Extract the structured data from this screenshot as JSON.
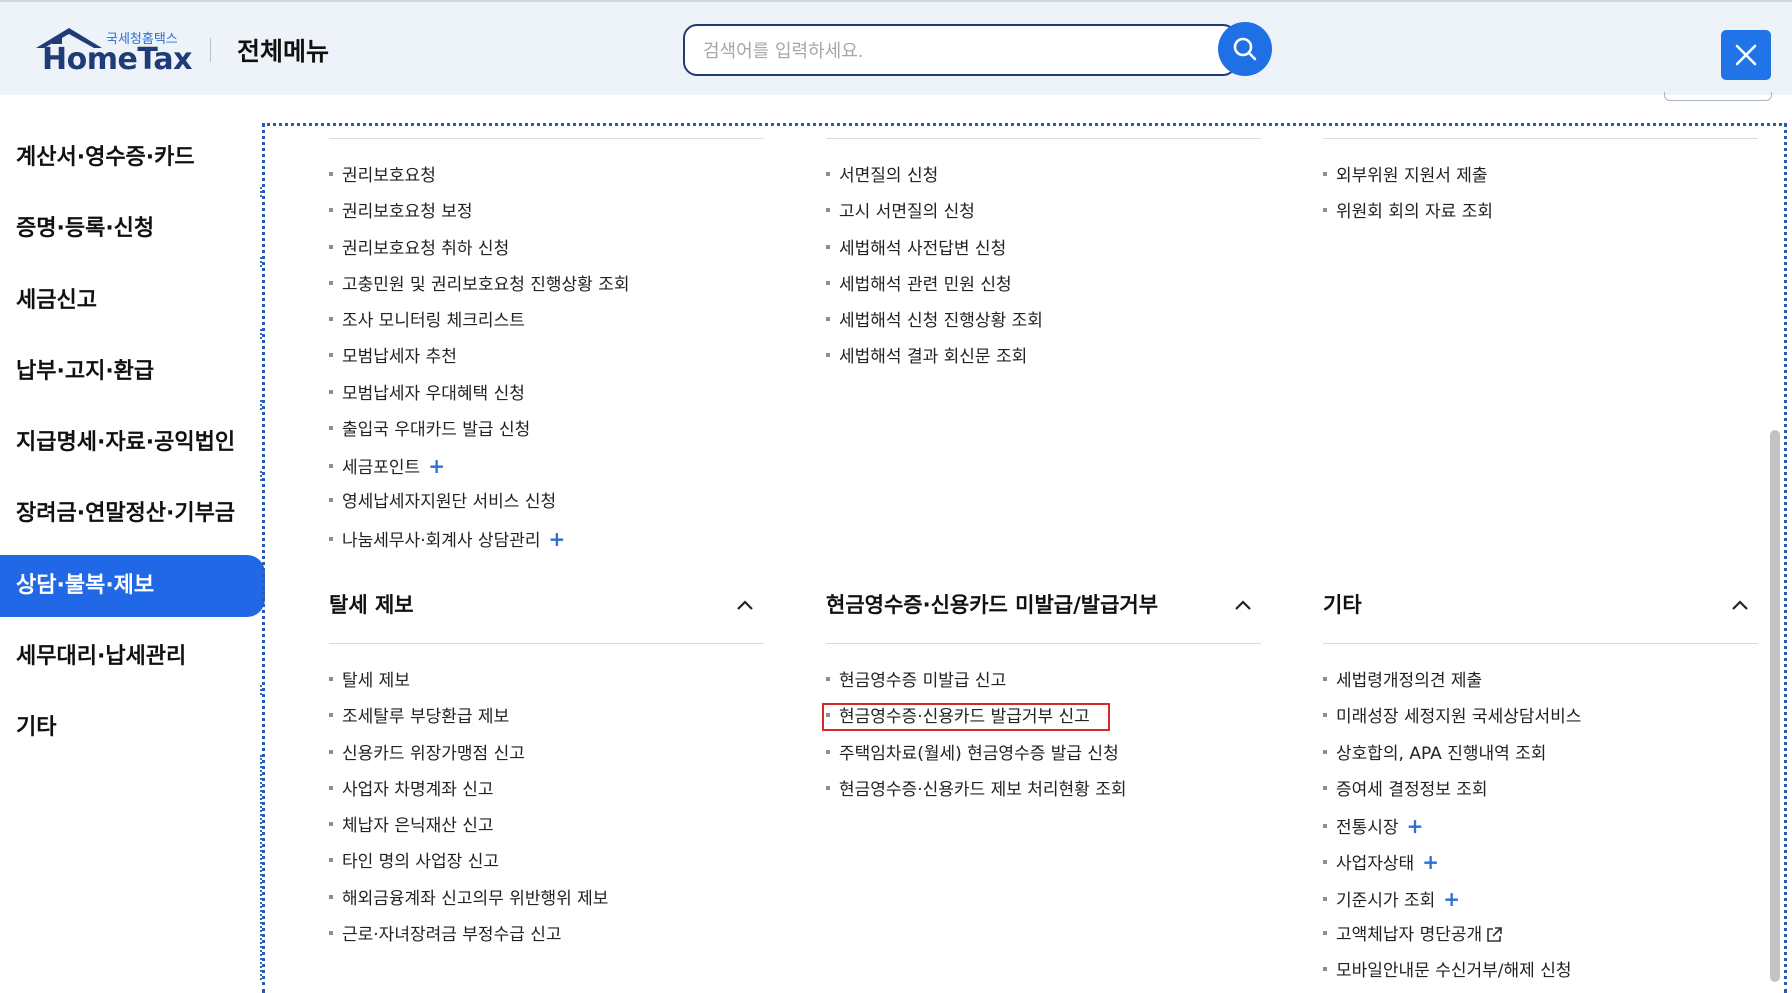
{
  "header": {
    "logo_sub": "국세청홈택스",
    "logo_main": "HomeTax",
    "title": "전체메뉴",
    "search_placeholder": "검색어를 입력하세요."
  },
  "sidebar": {
    "items": [
      {
        "label": "계산서·영수증·카드",
        "active": false
      },
      {
        "label": "증명·등록·신청",
        "active": false
      },
      {
        "label": "세금신고",
        "active": false
      },
      {
        "label": "납부·고지·환급",
        "active": false
      },
      {
        "label": "지급명세·자료·공익법인",
        "active": false
      },
      {
        "label": "장려금·연말정산·기부금",
        "active": false
      },
      {
        "label": "상담·불복·제보",
        "active": true
      },
      {
        "label": "세무대리·납세관리",
        "active": false
      },
      {
        "label": "기타",
        "active": false
      }
    ]
  },
  "upper": {
    "col1": [
      "권리보호요청",
      "권리보호요청 보정",
      "권리보호요청 취하 신청",
      "고충민원 및 권리보호요청 진행상황 조회",
      "조사 모니터링 체크리스트",
      "모범납세자 추천",
      "모범납세자 우대혜택 신청",
      "출입국 우대카드 발급 신청",
      "세금포인트",
      "영세납세자지원단 서비스 신청",
      "나눔세무사·회계사 상담관리"
    ],
    "col2": [
      "서면질의 신청",
      "고시 서면질의 신청",
      "세법해석 사전답변 신청",
      "세법해석 관련 민원 신청",
      "세법해석 신청 진행상황 조회",
      "세법해석 결과 회신문 조회"
    ],
    "col3": [
      "외부위원 지원서 제출",
      "위원회 회의 자료 조회"
    ]
  },
  "sections": {
    "report": {
      "title": "탈세 제보",
      "items": [
        "탈세 제보",
        "조세탈루 부당환급 제보",
        "신용카드 위장가맹점 신고",
        "사업자 차명계좌 신고",
        "체납자 은닉재산 신고",
        "타인 명의 사업장 신고",
        "해외금융계좌 신고의무 위반행위 제보",
        "근로·자녀장려금 부정수급 신고"
      ]
    },
    "receipt": {
      "title": "현금영수증·신용카드 미발급/발급거부",
      "items": [
        "현금영수증 미발급 신고",
        "현금영수증·신용카드 발급거부 신고",
        "주택임차료(월세) 현금영수증 발급 신청",
        "현금영수증·신용카드 제보 처리현황 조회"
      ]
    },
    "etc": {
      "title": "기타",
      "items": [
        "세법령개정의견 제출",
        "미래성장 세정지원 국세상담서비스",
        "상호합의, APA 진행내역 조회",
        "증여세 결정정보 조회",
        "전통시장",
        "사업자상태",
        "기준시가 조회",
        "고액체납자 명단공개",
        "모바일안내문 수신거부/해제 신청"
      ]
    }
  },
  "colors": {
    "accent": "#2068e6",
    "highlight": "#d62a2a",
    "plus": "#2a6fd6"
  }
}
